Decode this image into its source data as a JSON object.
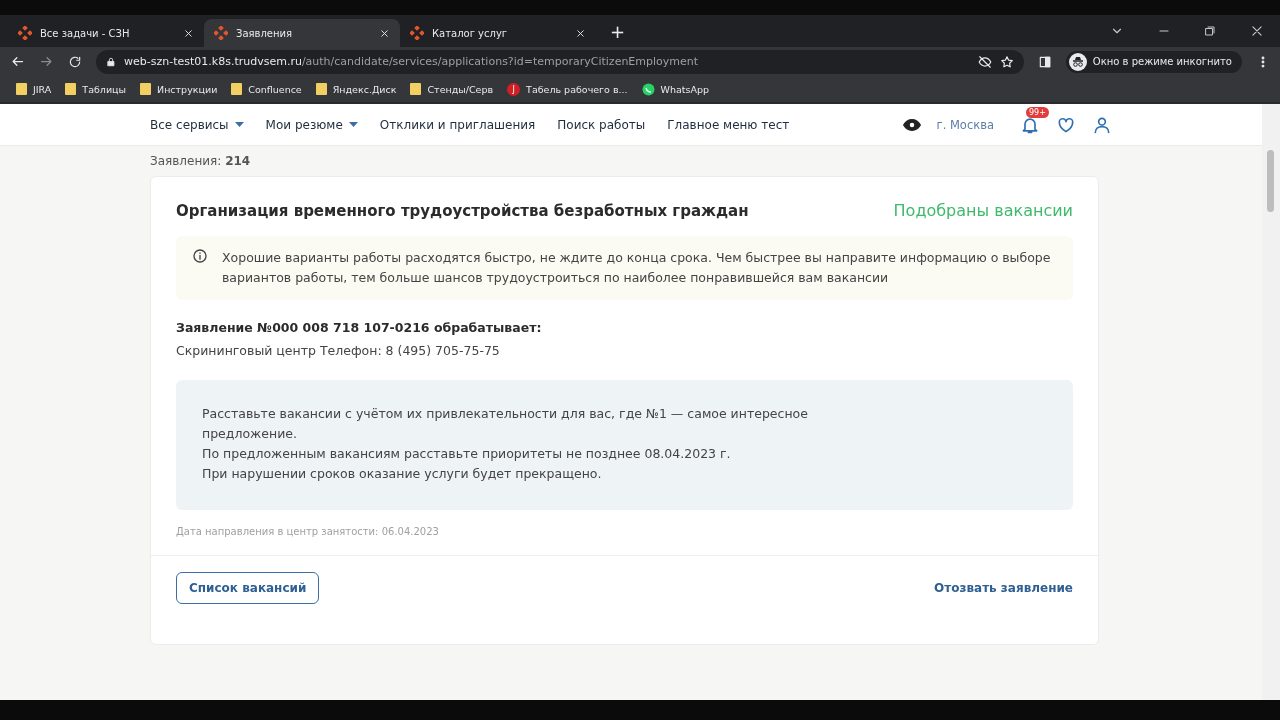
{
  "browser": {
    "tabs": [
      {
        "title": "Все задачи - СЗН",
        "selected": false
      },
      {
        "title": "Заявления",
        "selected": true
      },
      {
        "title": "Каталог услуг",
        "selected": false
      }
    ],
    "new_tab": "+",
    "url": {
      "host": "web-szn-test01.k8s.trudvsem.ru",
      "path": "/auth/candidate/services/applications?id=temporaryCitizenEmployment"
    },
    "profile": "Окно в режиме инкогнито",
    "bookmarks": [
      {
        "label": "JIRA",
        "kind": "folder"
      },
      {
        "label": "Таблицы",
        "kind": "folder"
      },
      {
        "label": "Инструкции",
        "kind": "folder"
      },
      {
        "label": "Confluence",
        "kind": "folder"
      },
      {
        "label": "Яндекс.Диск",
        "kind": "folder"
      },
      {
        "label": "Стенды/Серв",
        "kind": "folder"
      },
      {
        "label": "Табель рабочего в...",
        "kind": "letter",
        "letter": "J"
      },
      {
        "label": "WhatsApp",
        "kind": "chat"
      }
    ]
  },
  "header": {
    "nav": [
      {
        "label": "Все сервисы",
        "dropdown": true
      },
      {
        "label": "Мои резюме",
        "dropdown": true
      },
      {
        "label": "Отклики и приглашения",
        "dropdown": false
      },
      {
        "label": "Поиск работы",
        "dropdown": false
      },
      {
        "label": "Главное меню тест",
        "dropdown": false
      }
    ],
    "city": "г. Москва",
    "notifications": "99+"
  },
  "count_label": "Заявления: **214**",
  "card": {
    "title": "Организация временного трудоустройства безработных граждан",
    "status": "Подобраны вакансии",
    "notice": "Хорошие варианты работы расходятся быстро, не ждите до конца срока. Чем быстрее вы направите информацию о выборе вариантов работы, тем больше шансов трудоустроиться по наиболее понравившейся вам вакансии",
    "application_heading": "Заявление №000 008 718 107-0216 обрабатывает:",
    "processor": "Скрининговый центр Телефон: 8 (495) 705-75-75",
    "info_lines": [
      "Расставьте вакансии с учётом их привлекательности для вас, где №1 — самое интересное предложение.",
      "По предложенным вакансиям расставьте приоритеты не позднее 08.04.2023 г.",
      "При нарушении сроков оказание услуги будет прекращено."
    ],
    "date_sent": "Дата направления в центр занятости: 06.04.2023",
    "list_button": "Список вакансий",
    "withdraw_link": "Отозвать заявление"
  }
}
